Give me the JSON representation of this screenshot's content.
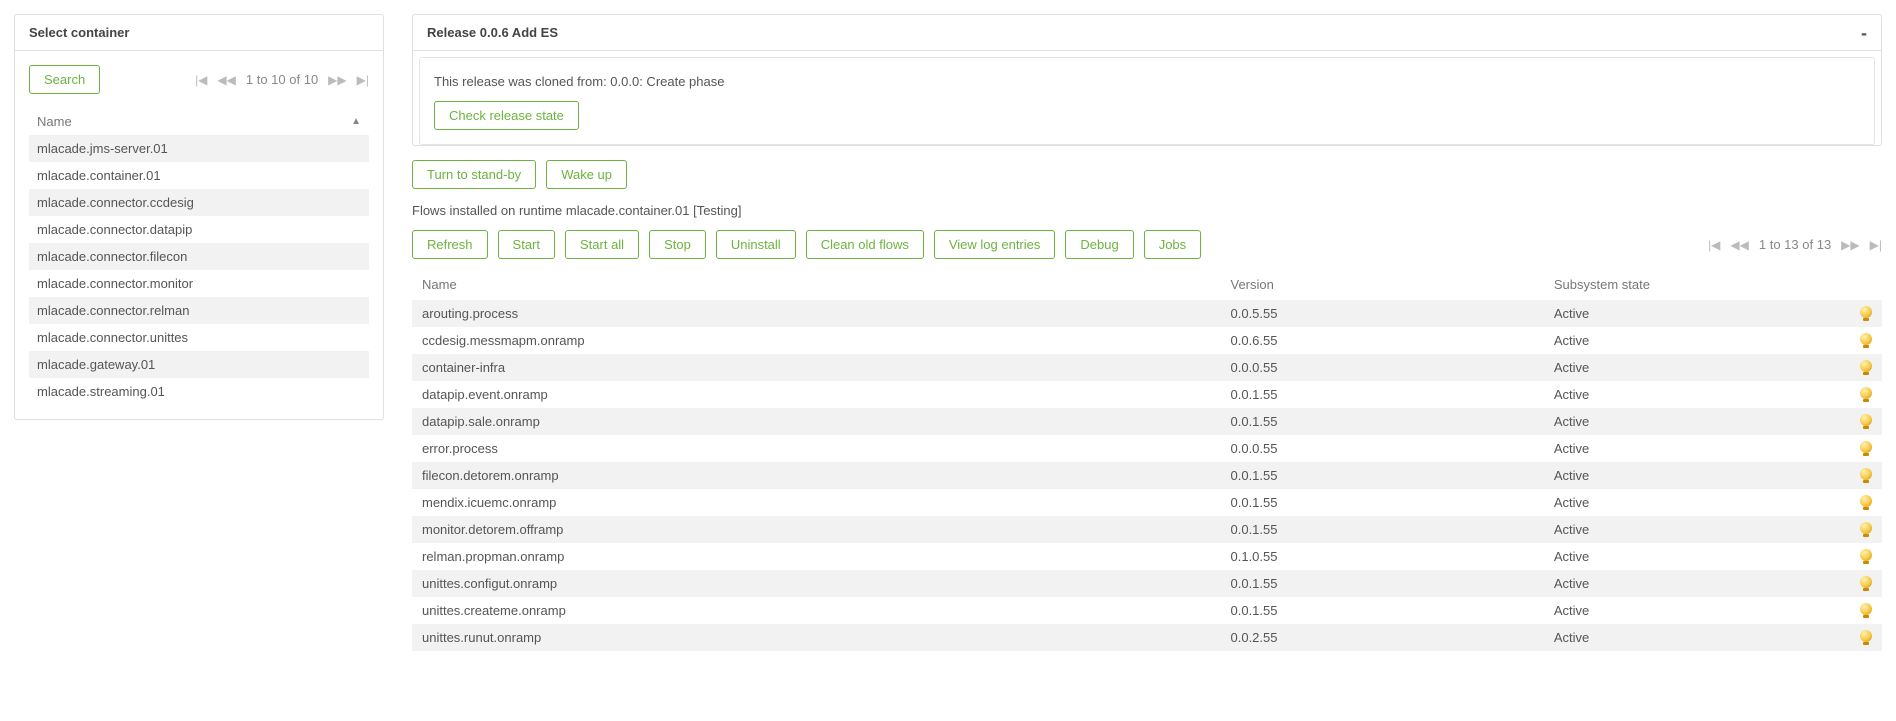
{
  "left": {
    "title": "Select container",
    "search_label": "Search",
    "pager": "1 to 10 of 10",
    "col_name": "Name",
    "items": [
      "mlacade.jms-server.01",
      "mlacade.container.01",
      "mlacade.connector.ccdesig",
      "mlacade.connector.datapip",
      "mlacade.connector.filecon",
      "mlacade.connector.monitor",
      "mlacade.connector.relman",
      "mlacade.connector.unittes",
      "mlacade.gateway.01",
      "mlacade.streaming.01"
    ]
  },
  "release": {
    "title": "Release 0.0.6 Add ES",
    "cloned_note": "This release was cloned from: 0.0.0: Create phase",
    "check_btn": "Check release state",
    "standby_btn": "Turn to stand-by",
    "wake_btn": "Wake up"
  },
  "flows": {
    "title": "Flows installed on runtime mlacade.container.01 [Testing]",
    "buttons": {
      "refresh": "Refresh",
      "start": "Start",
      "start_all": "Start all",
      "stop": "Stop",
      "uninstall": "Uninstall",
      "clean": "Clean old flows",
      "viewlog": "View log entries",
      "debug": "Debug",
      "jobs": "Jobs"
    },
    "pager": "1 to 13 of 13",
    "cols": {
      "name": "Name",
      "version": "Version",
      "state": "Subsystem state"
    },
    "rows": [
      {
        "name": "arouting.process",
        "version": "0.0.5.55",
        "state": "Active"
      },
      {
        "name": "ccdesig.messmapm.onramp",
        "version": "0.0.6.55",
        "state": "Active"
      },
      {
        "name": "container-infra",
        "version": "0.0.0.55",
        "state": "Active"
      },
      {
        "name": "datapip.event.onramp",
        "version": "0.0.1.55",
        "state": "Active"
      },
      {
        "name": "datapip.sale.onramp",
        "version": "0.0.1.55",
        "state": "Active"
      },
      {
        "name": "error.process",
        "version": "0.0.0.55",
        "state": "Active"
      },
      {
        "name": "filecon.detorem.onramp",
        "version": "0.0.1.55",
        "state": "Active"
      },
      {
        "name": "mendix.icuemc.onramp",
        "version": "0.0.1.55",
        "state": "Active"
      },
      {
        "name": "monitor.detorem.offramp",
        "version": "0.0.1.55",
        "state": "Active"
      },
      {
        "name": "relman.propman.onramp",
        "version": "0.1.0.55",
        "state": "Active"
      },
      {
        "name": "unittes.configut.onramp",
        "version": "0.0.1.55",
        "state": "Active"
      },
      {
        "name": "unittes.createme.onramp",
        "version": "0.0.1.55",
        "state": "Active"
      },
      {
        "name": "unittes.runut.onramp",
        "version": "0.0.2.55",
        "state": "Active"
      }
    ]
  }
}
